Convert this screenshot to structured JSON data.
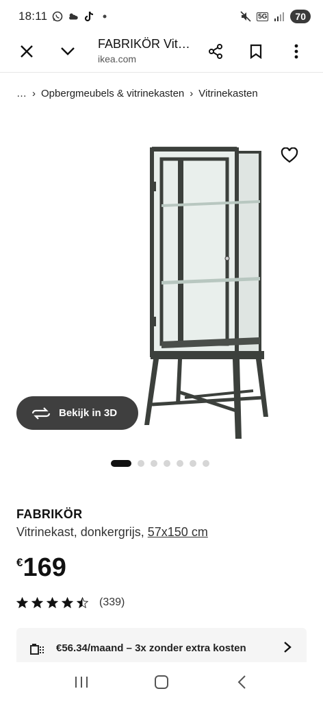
{
  "status_bar": {
    "time": "18:11",
    "left_icons": [
      "whatsapp-icon",
      "weather-icon",
      "tiktok-icon",
      "dot-icon"
    ],
    "network": "5G",
    "battery": "70"
  },
  "browser": {
    "title": "FABRIKÖR Vit…",
    "url": "ikea.com"
  },
  "breadcrumb": {
    "ellipsis": "…",
    "items": [
      "Opbergmeubels & vitrinekasten",
      "Vitrinekasten"
    ],
    "separator": "›"
  },
  "view_3d": {
    "label": "Bekijk in 3D"
  },
  "carousel": {
    "count": 7,
    "active_index": 0
  },
  "product": {
    "name": "FABRIKÖR",
    "description": "Vitrinekast, donkergrijs, ",
    "dimensions": "57x150 cm",
    "currency": "€",
    "price": "169",
    "rating": 4.5,
    "rating_count": "(339)"
  },
  "installment": {
    "text": "€56.34/maand – 3x zonder extra kosten"
  },
  "colors": {
    "accent_dark": "#3f3f3f",
    "cabinet": "#3c403c",
    "banner_bg": "#f5f5f5"
  }
}
